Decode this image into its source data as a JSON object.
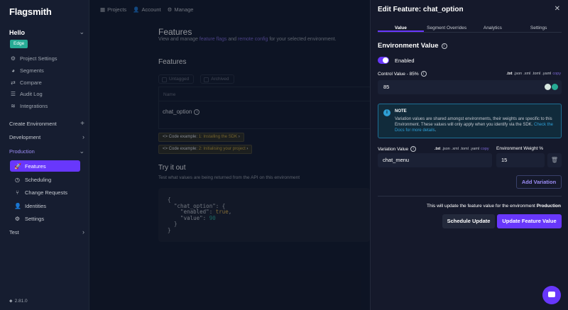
{
  "app": {
    "logo": "Flagsmith",
    "version": "2.81.0"
  },
  "topnav": {
    "projects": "Projects",
    "account": "Account",
    "manage": "Manage"
  },
  "sidebar": {
    "org": "Hello",
    "env_badge": "Edge",
    "items": [
      "Project Settings",
      "Segments",
      "Compare",
      "Audit Log",
      "Integrations"
    ],
    "create_environment": "Create Environment",
    "development": "Development",
    "production": "Production",
    "env_items": [
      "Features",
      "Scheduling",
      "Change Requests",
      "Identities",
      "Settings"
    ],
    "test": "Test"
  },
  "main": {
    "title": "Features",
    "subtitle_prefix": "View and manage ",
    "subtitle_link1": "feature flags",
    "subtitle_mid": " and ",
    "subtitle_link2": "remote config",
    "subtitle_suffix": " for your selected environment.",
    "section_title": "Features",
    "filter_untagged": "Untagged",
    "filter_archived": "Archived",
    "table_header": "Name",
    "feature_name": "chat_option",
    "code_example1_prefix": "<> Code example: ",
    "code_example1_hl": "1: Installing the SDK",
    "code_example1_arrow": " ›",
    "code_example2_prefix": "<> Code example: ",
    "code_example2_hl": "2: Initialising your project",
    "code_example2_arrow": " ›",
    "try_title": "Try it out",
    "try_sub": "Test what values are being returned from the API on this environment",
    "code_l1": "{",
    "code_l2_key": "  \"chat_option\": {",
    "code_l3_key": "    \"enabled\": ",
    "code_l3_val": "true",
    "code_l3_end": ",",
    "code_l4_key": "    \"value\": ",
    "code_l4_val": "90",
    "code_l5": "  }",
    "code_l6": "}"
  },
  "drawer": {
    "title": "Edit Feature: chat_option",
    "close": "✕",
    "tabs": [
      "Value",
      "Segment Overrides",
      "Analytics",
      "Settings"
    ],
    "env_value_title": "Environment Value",
    "enabled_label": "Enabled",
    "control_label": "Control Value - 85%",
    "formats": [
      ".txt",
      ".json",
      ".xml",
      ".toml",
      ".yaml"
    ],
    "copy": "copy",
    "control_value": "85",
    "note_title": "NOTE",
    "note_text": "Variation values are shared amongst environments, their weights are specific to this Environment. These values will only apply when you identify via the SDK.",
    "note_link": "Check the Docs for more details",
    "note_end": ".",
    "variation_label": "Variation Value",
    "weight_label": "Environment Weight %",
    "variation_value": "chat_menu",
    "weight_value": "15",
    "add_variation": "Add Variation",
    "update_note_prefix": "This will update the feature value for the environment ",
    "update_note_env": "Production",
    "schedule_btn": "Schedule Update",
    "update_btn": "Update Feature Value"
  },
  "colors": {
    "accent": "#6837fc",
    "edge_badge": "#27ab95",
    "note_border": "#1e6f95"
  }
}
